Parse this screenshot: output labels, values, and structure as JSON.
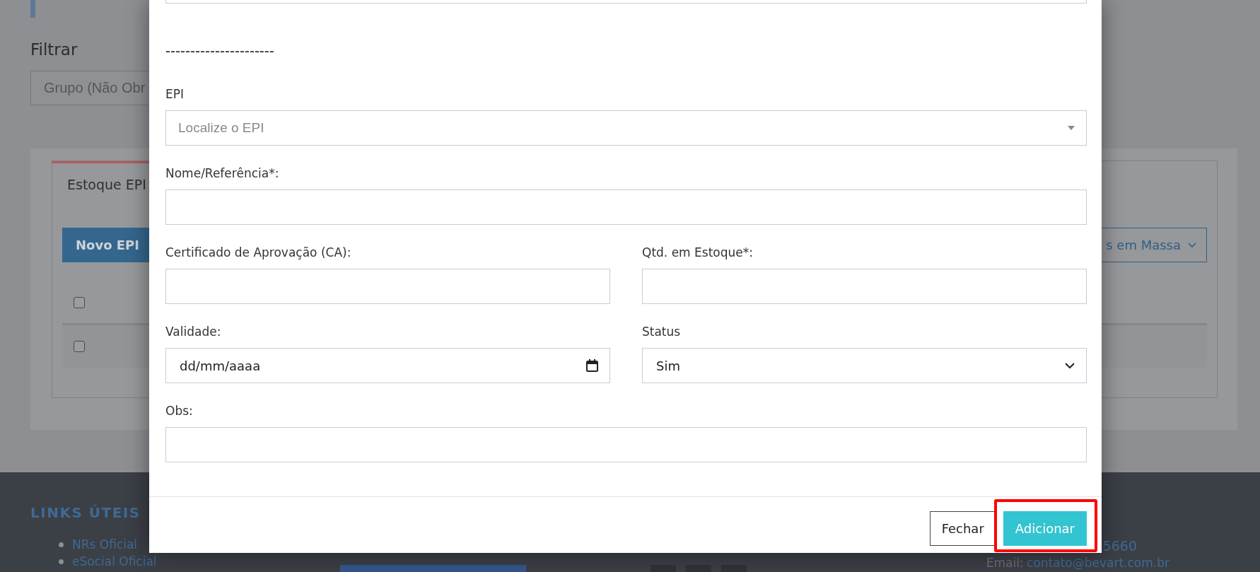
{
  "page": {
    "filter_title": "Filtrar",
    "group_filter": {
      "placeholder": "Grupo (Não Obr"
    },
    "tab": {
      "label": "Estoque EPI",
      "selected": true
    },
    "new_button": "Novo EPI",
    "mass_button": "s em Massa",
    "table": {
      "rows": [
        {
          "checked": false
        },
        {
          "checked": false
        }
      ]
    }
  },
  "footer": {
    "heading": "LINKS ÚTEIS",
    "links": [
      "NRs Oficial",
      "eSocial Oficial"
    ],
    "phone": "5660",
    "email_label": "Email:",
    "email": "contato@bevart.com.br"
  },
  "modal": {
    "divider_text": "----------------------",
    "rows": [
      [
        {
          "kind": "select",
          "label": "EPI",
          "placeholder": "Localize o EPI"
        }
      ],
      [
        {
          "kind": "text",
          "label": "Nome/Referência*:"
        }
      ],
      [
        {
          "kind": "text",
          "label": "Certificado de Aprovação (CA):"
        },
        {
          "kind": "text",
          "label": "Qtd. em Estoque*:"
        }
      ],
      [
        {
          "kind": "date",
          "label": "Validade:",
          "value": "dd/mm/aaaa"
        },
        {
          "kind": "dropdown",
          "label": "Status",
          "value": "Sim"
        }
      ],
      [
        {
          "kind": "text",
          "label": "Obs:"
        }
      ]
    ],
    "buttons": [
      {
        "label": "Fechar",
        "kind": "secondary",
        "highlighted": false
      },
      {
        "label": "Adicionar",
        "kind": "primary",
        "highlighted": true
      }
    ]
  }
}
